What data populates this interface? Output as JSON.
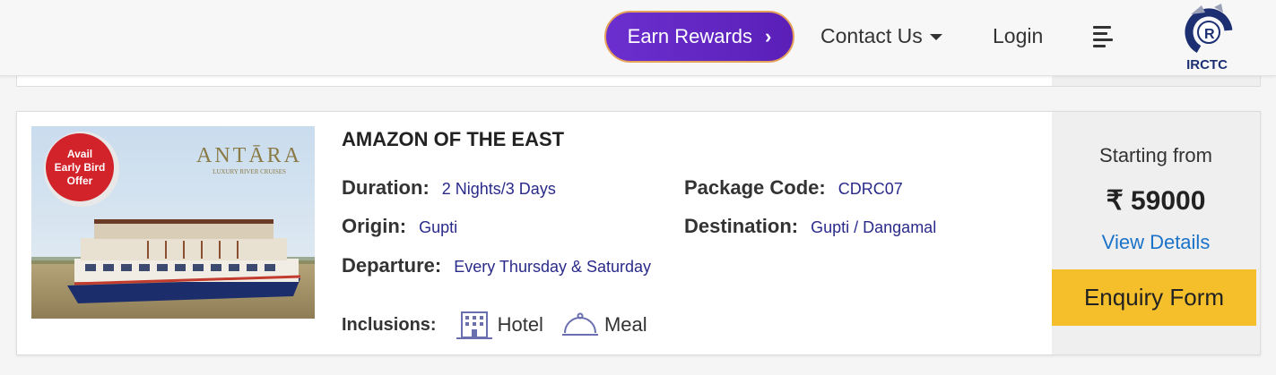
{
  "header": {
    "earn_rewards": "Earn Rewards",
    "contact_us": "Contact Us",
    "login": "Login",
    "logo_text": "IRCTC"
  },
  "package": {
    "title": "AMAZON OF THE EAST",
    "image": {
      "badge": [
        "Avail",
        "Early Bird",
        "Offer"
      ],
      "brand": "ANTĀRA",
      "brand_sub": "LUXURY RIVER CRUISES"
    },
    "duration": {
      "label": "Duration:",
      "value": "2 Nights/3 Days"
    },
    "package_code": {
      "label": "Package Code:",
      "value": "CDRC07"
    },
    "origin": {
      "label": "Origin:",
      "value": "Gupti"
    },
    "destination": {
      "label": "Destination:",
      "value": "Gupti / Dangamal"
    },
    "departure": {
      "label": "Departure:",
      "value": "Every Thursday & Saturday"
    },
    "inclusions": {
      "label": "Inclusions:",
      "items": [
        "Hotel",
        "Meal"
      ]
    },
    "starting_from": "Starting from",
    "price": "₹ 59000",
    "view_details": "View Details",
    "enquiry_form": "Enquiry Form"
  },
  "colors": {
    "earn_btn": "#6b2fcf",
    "enquiry_btn": "#f4bf2a",
    "link": "#1a73c9",
    "value_text": "#2a2a8a"
  }
}
